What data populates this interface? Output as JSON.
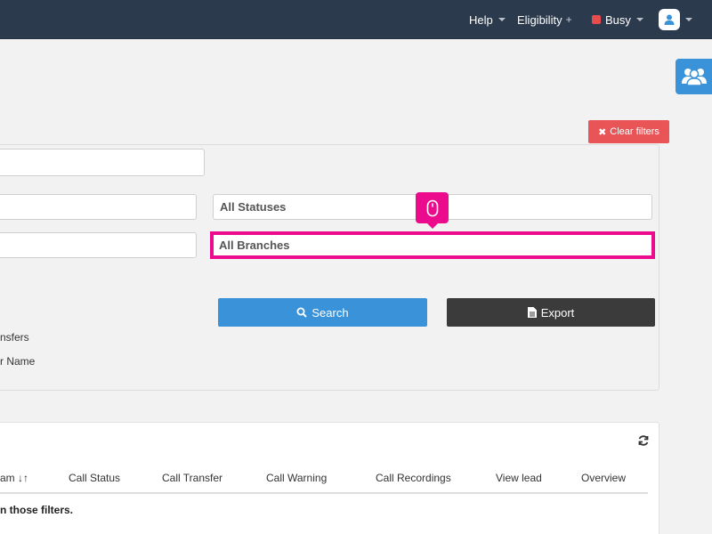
{
  "navbar": {
    "help_label": "Help",
    "eligibility_label": "Eligibility",
    "eligibility_plus": "+",
    "status_label": "Busy",
    "status_color": "#e84c4c"
  },
  "team_button": {
    "icon": "users-icon"
  },
  "filters": {
    "clear_label": "Clear filters",
    "statuses_value": "All Statuses",
    "branches_value": "All Branches",
    "search_label": "Search",
    "export_label": "Export",
    "transfers_label_partial": "nsfers",
    "name_label_partial": "r Name"
  },
  "results": {
    "columns": [
      "am",
      "Call Status",
      "Call Transfer",
      "Call Warning",
      "Call Recordings",
      "View lead",
      "Overview"
    ],
    "empty_message_partial": "n those filters."
  },
  "colors": {
    "navbar_bg": "#2c3a4d",
    "accent_blue": "#3a92d8",
    "danger_red": "#e95457",
    "highlight_pink": "#ec0b8d",
    "export_dark": "#3b3b3b"
  }
}
